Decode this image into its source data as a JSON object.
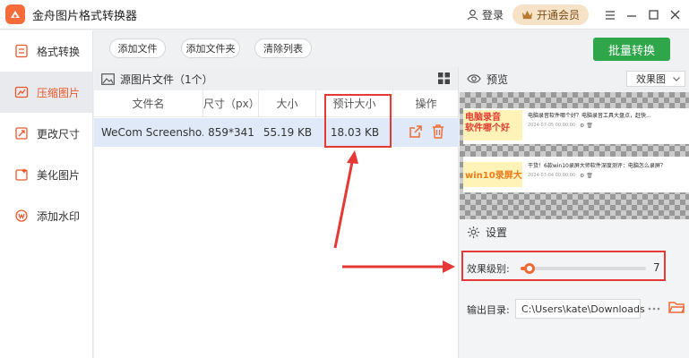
{
  "app": {
    "title": "金舟图片格式转换器"
  },
  "header": {
    "login_label": "登录",
    "vip_label": "开通会员"
  },
  "sidebar": {
    "items": [
      {
        "label": "格式转换",
        "icon": "convert-icon"
      },
      {
        "label": "压缩图片",
        "icon": "compress-icon",
        "active": true
      },
      {
        "label": "更改尺寸",
        "icon": "resize-icon"
      },
      {
        "label": "美化图片",
        "icon": "beautify-icon"
      },
      {
        "label": "添加水印",
        "icon": "watermark-icon"
      }
    ]
  },
  "toolbar": {
    "add_file": "添加文件",
    "add_folder": "添加文件夹",
    "clear_list": "清除列表",
    "batch_convert": "批量转换"
  },
  "file_panel": {
    "header": "源图片文件（1个）",
    "columns": [
      "文件名",
      "尺寸（px）",
      "大小",
      "预计大小",
      "操作"
    ],
    "rows": [
      {
        "name": "WeCom Screensho...",
        "dimensions": "859*341",
        "size": "55.19 KB",
        "estimated": "18.03 KB"
      }
    ]
  },
  "preview": {
    "title": "预览",
    "mode": "效果图",
    "article1": {
      "title": "电脑录音软件哪个好？电脑录音工具大盘点，赶快...",
      "thumb_text": "电脑录音\n软件哪个好",
      "date": "2024-07-05 00:00:00"
    },
    "article2": {
      "title": "干货！6款win10录屏大师软件深度测评：电脑怎么录屏？",
      "thumb_text": "win10录屏大",
      "date": "2024-07-04 00:00:00"
    }
  },
  "settings": {
    "title": "设置",
    "quality_label": "效果级别:",
    "quality_value": "7",
    "quality_fraction": 0.07,
    "output_label": "输出目录:",
    "output_path": "C:\\Users\\kate\\Downloads"
  },
  "colors": {
    "accent": "#f06a37",
    "green": "#2fa64a",
    "highlight_red": "#e53935"
  }
}
